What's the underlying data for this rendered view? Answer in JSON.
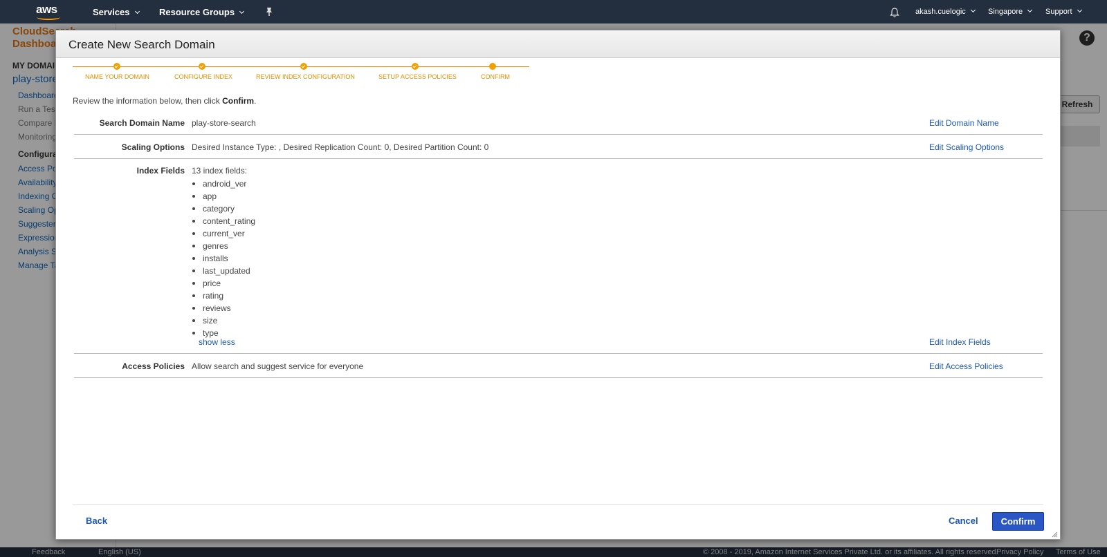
{
  "topnav": {
    "logo": "aws",
    "services": "Services",
    "resource_groups": "Resource Groups",
    "user": "akash.cuelogic",
    "region": "Singapore",
    "support": "Support"
  },
  "background": {
    "title": "CloudSearch Dashboard",
    "my_domains": "MY DOMAINS",
    "domain": "play-store-search",
    "links": [
      "Dashboard",
      "Run a Test Search",
      "Compare Results",
      "Monitoring"
    ],
    "config_heading": "Configuration",
    "config_links": [
      "Access Policies",
      "Availability Options",
      "Indexing Options",
      "Scaling Options",
      "Suggesters",
      "Expressions",
      "Analysis Schemes",
      "Manage Tags"
    ],
    "refresh": "Refresh",
    "help": "?"
  },
  "footer": {
    "feedback": "Feedback",
    "language": "English (US)",
    "copyright": "© 2008 - 2019, Amazon Internet Services Private Ltd. or its affiliates. All rights reserved.",
    "privacy": "Privacy Policy",
    "terms": "Terms of Use"
  },
  "modal": {
    "title": "Create New Search Domain",
    "steps": [
      "NAME YOUR DOMAIN",
      "CONFIGURE INDEX",
      "REVIEW INDEX CONFIGURATION",
      "SETUP ACCESS POLICIES",
      "CONFIRM"
    ],
    "intro_text": "Review the information below, then click ",
    "intro_bold": "Confirm",
    "intro_end": ".",
    "rows": {
      "domain_name": {
        "label": "Search Domain Name",
        "value": "play-store-search",
        "edit": "Edit Domain Name"
      },
      "scaling": {
        "label": "Scaling Options",
        "value": "Desired Instance Type: , Desired Replication Count: 0, Desired Partition Count: 0",
        "edit": "Edit Scaling Options"
      },
      "index_fields": {
        "label": "Index Fields",
        "summary": "13 index fields:",
        "fields": [
          "android_ver",
          "app",
          "category",
          "content_rating",
          "current_ver",
          "genres",
          "installs",
          "last_updated",
          "price",
          "rating",
          "reviews",
          "size",
          "type"
        ],
        "show_less": "show less",
        "edit": "Edit Index Fields"
      },
      "access": {
        "label": "Access Policies",
        "value": "Allow search and suggest service for everyone",
        "edit": "Edit Access Policies"
      }
    },
    "buttons": {
      "back": "Back",
      "cancel": "Cancel",
      "confirm": "Confirm"
    }
  },
  "colors": {
    "accent": "#e28e00",
    "link": "#1a57b8",
    "primary_button": "#2a56c6",
    "nav_bg": "#232f3e"
  }
}
